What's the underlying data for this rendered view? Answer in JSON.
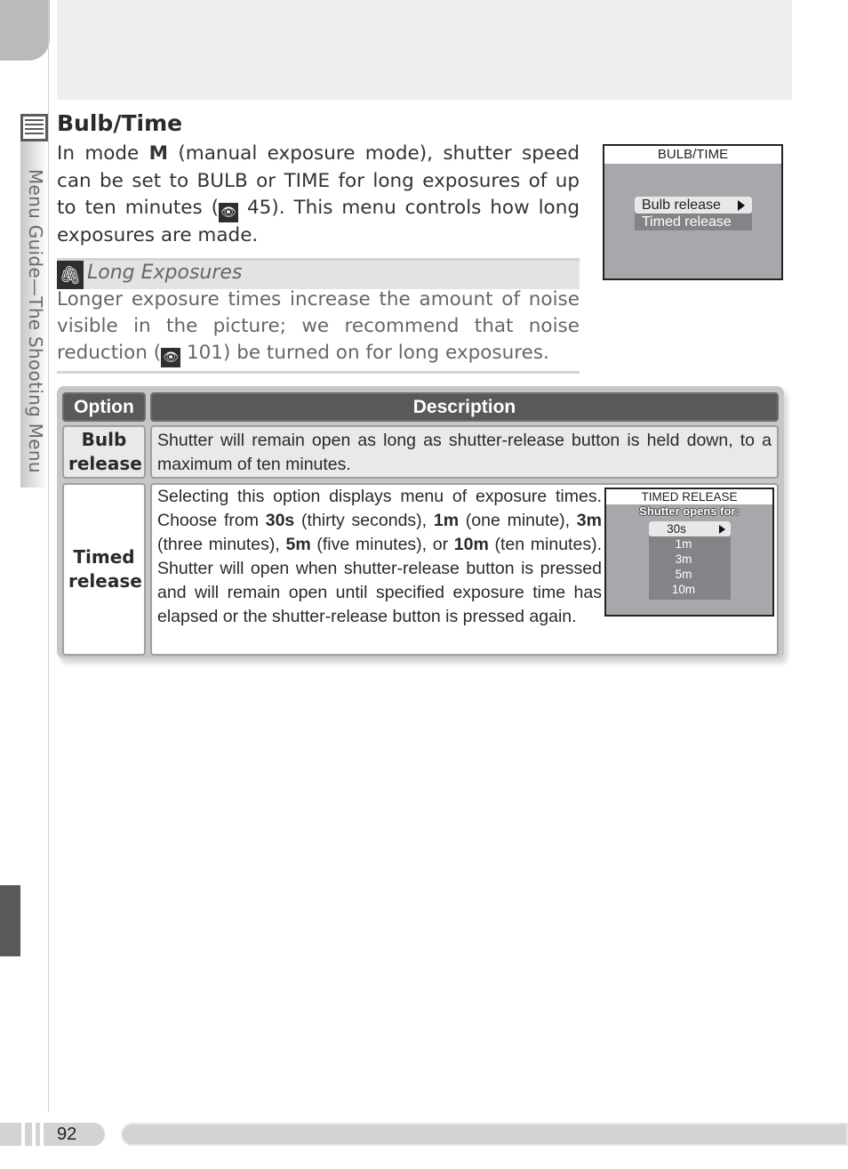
{
  "side_label": "Menu Guide—The Shooting Menu",
  "section": {
    "title": "Bulb/Time",
    "intro_parts": {
      "p1": "In mode ",
      "mode": "M",
      "p2": " (manual exposure mode), shutter speed can be set to BULB or TIME for long exposures of up to ten minutes (",
      "ref": "45",
      "p3": ").  This menu controls how long exposures are made."
    }
  },
  "lcd_main": {
    "header": "BULB/TIME",
    "options": [
      "Bulb release",
      "Timed release"
    ],
    "selected_index": 0
  },
  "note": {
    "icon": "paperclip-icon",
    "title": "Long Exposures",
    "p1": "Longer exposure times increase the amount of noise visible in the picture; we recommend that noise reduction (",
    "ref": "101",
    "p2": ") be turned on for long exposures."
  },
  "table": {
    "headers": {
      "option": "Option",
      "description": "Description"
    },
    "rows": [
      {
        "option": "Bulb release",
        "description": "Shutter will remain open as long as shutter-release button is held down, to a maximum of ten minutes."
      },
      {
        "option": "Timed release",
        "desc_parts": [
          "Selecting this option displays menu of exposure times.  Choose from ",
          "30s",
          " (thirty seconds), ",
          "1m",
          " (one minute), ",
          "3m",
          " (three minutes), ",
          "5m",
          " (five minutes), or ",
          "10m",
          " (ten minutes).  Shutter will open when shutter-release button is pressed and will remain open until specified exposure time has elapsed or the shutter-release button is pressed again."
        ]
      }
    ]
  },
  "lcd_timed": {
    "header": "TIMED RELEASE",
    "subtitle": "Shutter opens for:",
    "options": [
      "30s",
      "1m",
      "3m",
      "5m",
      "10m"
    ],
    "selected_index": 0
  },
  "footer": {
    "page_number": "92"
  }
}
